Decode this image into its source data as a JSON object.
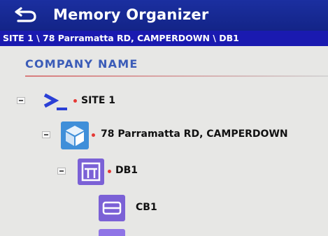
{
  "header": {
    "title": "Memory Organizer",
    "back_icon": "back-arrow-icon"
  },
  "breadcrumb": "SITE 1 \\ 78 Parramatta RD, CAMPERDOWN \\ DB1",
  "company": "COMPANY NAME",
  "tree": {
    "site": {
      "label": "SITE 1",
      "icon": "site-prompt-icon"
    },
    "address": {
      "label": "78 Parramatta RD, CAMPERDOWN",
      "icon": "building-cube-icon"
    },
    "db": {
      "label": "DB1",
      "icon": "distribution-board-icon"
    },
    "cb": {
      "label": "CB1",
      "icon": "circuit-breaker-icon"
    }
  },
  "colors": {
    "title_bar": "#1b2fa0",
    "breadcrumb_bar": "#1a1ab0",
    "company_text": "#3b5cb8",
    "marker_dot": "#e53935",
    "icon_purple": "#7b61d6"
  }
}
